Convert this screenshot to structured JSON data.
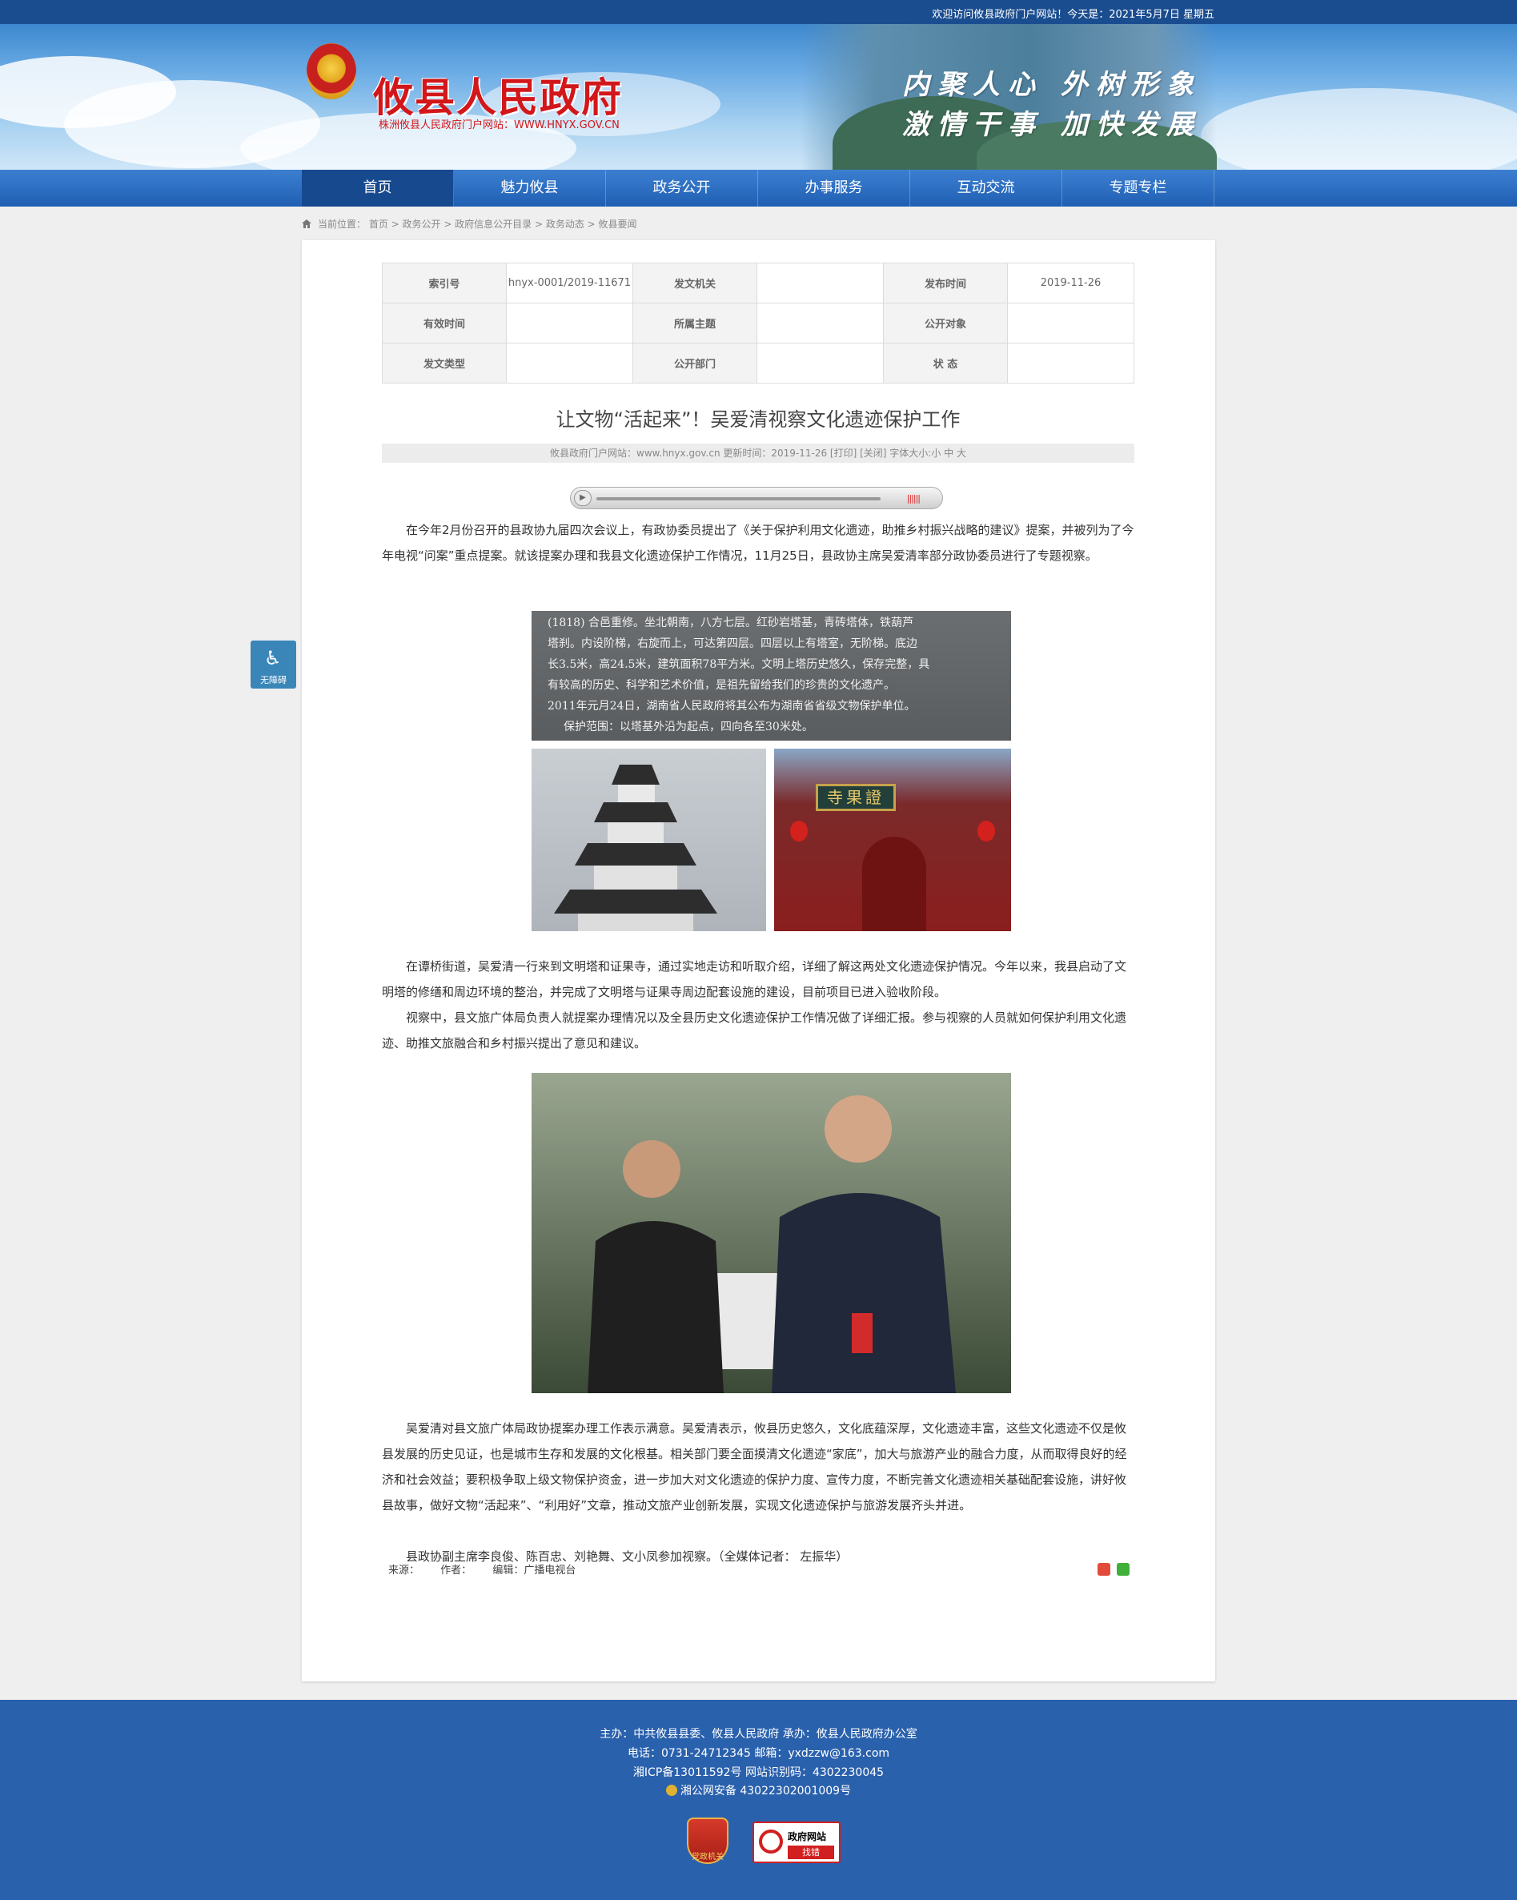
{
  "topbar": {
    "welcome": "欢迎访问攸县政府门户网站！今天是：2021年5月7日 星期五"
  },
  "header": {
    "site_title": "攸县人民政府",
    "site_subtitle": "株洲攸县人民政府门户网站：WWW.HNYX.GOV.CN",
    "slogan_line1": "内聚人心 外树形象",
    "slogan_line2": "激情干事 加快发展"
  },
  "nav": [
    "首页",
    "魅力攸县",
    "政务公开",
    "办事服务",
    "互动交流",
    "专题专栏"
  ],
  "breadcrumb": "当前位置： 首页 > 政务公开 > 政府信息公开目录 > 政务动态 > 攸县要闻",
  "meta": {
    "index_label": "索引号",
    "index_value": "hnyx-0001/2019-11671",
    "issuer_label": "发文机关",
    "issuer_value": "",
    "pubdate_label": "发布时间",
    "pubdate_value": "2019-11-26",
    "valid_label": "有效时间",
    "valid_value": "",
    "topic_label": "所属主题",
    "topic_value": "",
    "audience_label": "公开对象",
    "audience_value": "",
    "doctype_label": "发文类型",
    "doctype_value": "",
    "dept_label": "公开部门",
    "dept_value": "",
    "status_label": "状 态",
    "status_value": ""
  },
  "article": {
    "title": "让文物“活起来”！吴爱清视察文化遗迹保护工作",
    "info": "攸县政府门户网站：www.hnyx.gov.cn  更新时间：2019-11-26  [打印] [关闭]  字体大小:小 中 大",
    "p1": "在今年2月份召开的县政协九届四次会议上，有政协委员提出了《关于保护利用文化遗迹，助推乡村振兴战略的建议》提案，并被列为了今年电视“问案”重点提案。就该提案办理和我县文化遗迹保护工作情况，11月25日，县政协主席吴爱清率部分政协委员进行了专题视察。",
    "p2": "在谭桥街道，吴爱清一行来到文明塔和证果寺，通过实地走访和听取介绍，详细了解这两处文化遗迹保护情况。今年以来，我县启动了文明塔的修缮和周边环境的整治，并完成了文明塔与证果寺周边配套设施的建设，目前项目已进入验收阶段。",
    "p3": "视察中，县文旅广体局负责人就提案办理情况以及全县历史文化遗迹保护工作情况做了详细汇报。参与视察的人员就如何保护利用文化遗迹、助推文旅融合和乡村振兴提出了意见和建议。",
    "p4": "吴爱清对县文旅广体局政协提案办理工作表示满意。吴爱清表示，攸县历史悠久，文化底蕴深厚，文化遗迹丰富，这些文化遗迹不仅是攸县发展的历史见证，也是城市生存和发展的文化根基。相关部门要全面摸清文化遗迹“家底”，加大与旅游产业的融合力度，从而取得良好的经济和社会效益；要积极争取上级文物保护资金，进一步加大对文化遗迹的保护力度、宣传力度，不断完善文化遗迹相关基础配套设施，讲好攸县故事，做好文物“活起来”、“利用好”文章，推动文旅产业创新发展，实现文化遗迹保护与旅游发展齐头并进。",
    "p5": "县政协副主席李良俊、陈百忠、刘艳舞、文小凤参加视察。（全媒体记者： 左振华）",
    "stele_lines": [
      "(1818) 合邑重修。坐北朝南，八方七层。红砂岩塔基，青砖塔体，铁葫芦",
      "塔刹。内设阶梯，右旋而上，可达第四层。四层以上有塔室，无阶梯。底边",
      "长3.5米，高24.5米，建筑面积78平方米。文明上塔历史悠久，保存完整，具",
      "有较高的历史、科学和艺术价值，是祖先留给我们的珍贵的文化遗产。",
      "2011年元月24日，湖南省人民政府将其公布为湖南省省级文物保护单位。",
      "保护范围：以塔基外沿为起点，四向各至30米处。"
    ],
    "temple_plaque": "寺果證",
    "source_label": "来源：",
    "author_label": "作者：",
    "editor_label": "编辑：广播电视台"
  },
  "accessibility": {
    "label": "无障碍"
  },
  "footer": {
    "line1": "主办：中共攸县县委、攸县人民政府  承办：攸县人民政府办公室",
    "line2": "电话：0731-24712345  邮箱：yxdzzw@163.com",
    "line3": "湘ICP备13011592号    网站识别码：4302230045",
    "line4": "湘公网安备 43022302001009号",
    "badge1_text": "党政机关",
    "badge2_line1": "政府网站",
    "badge2_line2": "找错"
  },
  "colors": {
    "brand_blue": "#2a61ad",
    "nav_blue": "#1f5fb3",
    "title_red": "#d2171b"
  }
}
